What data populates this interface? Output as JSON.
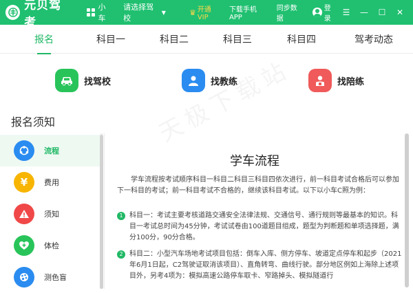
{
  "app": {
    "logo_text": "元贝驾考",
    "car_type": "小车",
    "school_select": "请选择驾校",
    "vip": "开通VIP",
    "download": "下载手机APP",
    "sync": "同步数据",
    "login": "登录"
  },
  "window": {
    "skin": "☰",
    "minimize": "—",
    "maximize": "☐",
    "close": "✕"
  },
  "tabs": [
    {
      "label": "报名",
      "active": true
    },
    {
      "label": "科目一"
    },
    {
      "label": "科目二"
    },
    {
      "label": "科目三"
    },
    {
      "label": "科目四"
    },
    {
      "label": "驾考动态"
    }
  ],
  "features": [
    {
      "label": "找驾校",
      "icon": "car-icon",
      "color": "#28c45a"
    },
    {
      "label": "找教练",
      "icon": "coach-icon",
      "color": "#2a8cf0"
    },
    {
      "label": "找陪练",
      "icon": "companion-icon",
      "color": "#f05a5a"
    }
  ],
  "section_title": "报名须知",
  "sidebar": {
    "items": [
      {
        "label": "流程",
        "icon": "flow-icon",
        "color": "#2a8cf0",
        "active": true
      },
      {
        "label": "费用",
        "icon": "yen-icon",
        "color": "#f7b500"
      },
      {
        "label": "须知",
        "icon": "warning-icon",
        "color": "#f04848"
      },
      {
        "label": "体检",
        "icon": "health-icon",
        "color": "#28c45a"
      },
      {
        "label": "测色盲",
        "icon": "palette-icon",
        "color": "#2a8cf0"
      }
    ]
  },
  "content": {
    "title": "学车流程",
    "intro": "学车流程按考试顺序科目一科目二科目三科目四依次进行，前一科目考试合格后可以参加下一科目的考试；前一科目考试不合格的，继续该科目考试。以下以小车C照为例：",
    "steps": [
      {
        "num": "1",
        "text": "科目一：考试主要考核道路交通安全法律法规、交通信号、通行规则等最基本的知识。科目一考试总时间为45分钟，考试试卷由100道题目组成，题型为判断题和单项选择题，满分100分，90分合格。"
      },
      {
        "num": "2",
        "text": "科目二：小型汽车场地考试项目包括：倒车入库、侧方停车、坡道定点停车和起步（2021年6月1日起，C2驾驶证取消该项目）、直角转弯、曲线行驶。部分地区例如上海除上述项目外，另考4项为：模拟高速公路停车取卡、窄路掉头、模拟隧道行"
      }
    ]
  },
  "watermark": "天极下载站",
  "colors": {
    "brand": "#20c070",
    "accent": "#20b865"
  }
}
